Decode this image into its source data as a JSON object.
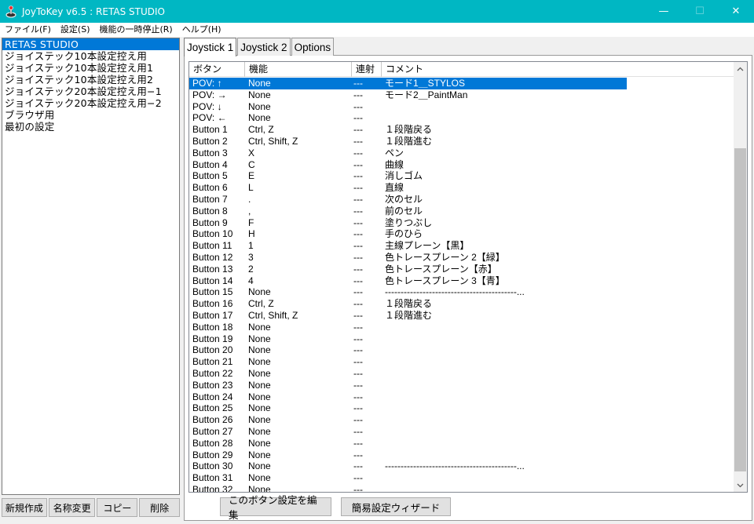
{
  "window": {
    "title": "JoyToKey v6.5 : RETAS STUDIO",
    "minimize": "—",
    "maximize": "☐",
    "close": "✕"
  },
  "menubar": [
    "ファイル(F)",
    "設定(S)",
    "機能の一時停止(R)",
    "ヘルプ(H)"
  ],
  "profiles": {
    "selected_index": 0,
    "items": [
      "RETAS STUDIO",
      "ジョイステック10本設定控え用",
      "ジョイステック10本設定控え用1",
      "ジョイステック10本設定控え用2",
      "ジョイステック20本設定控え用−1",
      "ジョイステック20本設定控え用−2",
      "ブラウザ用",
      "最初の設定"
    ]
  },
  "profile_buttons": {
    "new": "新規作成",
    "rename": "名称変更",
    "copy": "コピー",
    "delete": "削除"
  },
  "tabs": [
    {
      "label": "Joystick 1",
      "active": true
    },
    {
      "label": "Joystick 2",
      "active": false
    },
    {
      "label": "Options",
      "active": false
    }
  ],
  "table": {
    "headers": [
      "ボタン",
      "機能",
      "連射",
      "コメント"
    ],
    "rows": [
      {
        "button": "POV: ↑",
        "func": "None",
        "rapid": "---",
        "comment": "モード1＿STYLOS",
        "selected": true
      },
      {
        "button": "POV: →",
        "func": "None",
        "rapid": "---",
        "comment": "モード2＿PaintMan"
      },
      {
        "button": "POV: ↓",
        "func": "None",
        "rapid": "---",
        "comment": ""
      },
      {
        "button": "POV: ←",
        "func": "None",
        "rapid": "---",
        "comment": ""
      },
      {
        "button": "Button 1",
        "func": "Ctrl, Z",
        "rapid": "---",
        "comment": "１段階戻る"
      },
      {
        "button": "Button 2",
        "func": "Ctrl, Shift, Z",
        "rapid": "---",
        "comment": "１段階進む"
      },
      {
        "button": "Button 3",
        "func": "X",
        "rapid": "---",
        "comment": "ペン"
      },
      {
        "button": "Button 4",
        "func": "C",
        "rapid": "---",
        "comment": "曲線"
      },
      {
        "button": "Button 5",
        "func": "E",
        "rapid": "---",
        "comment": "消しゴム"
      },
      {
        "button": "Button 6",
        "func": "L",
        "rapid": "---",
        "comment": "直線"
      },
      {
        "button": "Button 7",
        "func": ".",
        "rapid": "---",
        "comment": "次のセル"
      },
      {
        "button": "Button 8",
        "func": ",",
        "rapid": "---",
        "comment": "前のセル"
      },
      {
        "button": "Button 9",
        "func": "F",
        "rapid": "---",
        "comment": "塗りつぶし"
      },
      {
        "button": "Button 10",
        "func": "H",
        "rapid": "---",
        "comment": "手のひら"
      },
      {
        "button": "Button 11",
        "func": "1",
        "rapid": "---",
        "comment": "主線プレーン【黒】"
      },
      {
        "button": "Button 12",
        "func": "3",
        "rapid": "---",
        "comment": "色トレースプレーン 2【緑】"
      },
      {
        "button": "Button 13",
        "func": "2",
        "rapid": "---",
        "comment": "色トレースプレーン【赤】"
      },
      {
        "button": "Button 14",
        "func": "4",
        "rapid": "---",
        "comment": "色トレースプレーン 3【青】"
      },
      {
        "button": "Button 15",
        "func": "None",
        "rapid": "---",
        "comment": "------------------------------------------..."
      },
      {
        "button": "Button 16",
        "func": "Ctrl, Z",
        "rapid": "---",
        "comment": "１段階戻る"
      },
      {
        "button": "Button 17",
        "func": "Ctrl, Shift, Z",
        "rapid": "---",
        "comment": "１段階進む"
      },
      {
        "button": "Button 18",
        "func": "None",
        "rapid": "---",
        "comment": ""
      },
      {
        "button": "Button 19",
        "func": "None",
        "rapid": "---",
        "comment": ""
      },
      {
        "button": "Button 20",
        "func": "None",
        "rapid": "---",
        "comment": ""
      },
      {
        "button": "Button 21",
        "func": "None",
        "rapid": "---",
        "comment": ""
      },
      {
        "button": "Button 22",
        "func": "None",
        "rapid": "---",
        "comment": ""
      },
      {
        "button": "Button 23",
        "func": "None",
        "rapid": "---",
        "comment": ""
      },
      {
        "button": "Button 24",
        "func": "None",
        "rapid": "---",
        "comment": ""
      },
      {
        "button": "Button 25",
        "func": "None",
        "rapid": "---",
        "comment": ""
      },
      {
        "button": "Button 26",
        "func": "None",
        "rapid": "---",
        "comment": ""
      },
      {
        "button": "Button 27",
        "func": "None",
        "rapid": "---",
        "comment": ""
      },
      {
        "button": "Button 28",
        "func": "None",
        "rapid": "---",
        "comment": ""
      },
      {
        "button": "Button 29",
        "func": "None",
        "rapid": "---",
        "comment": ""
      },
      {
        "button": "Button 30",
        "func": "None",
        "rapid": "---",
        "comment": "------------------------------------------..."
      },
      {
        "button": "Button 31",
        "func": "None",
        "rapid": "---",
        "comment": ""
      },
      {
        "button": "Button 32",
        "func": "None",
        "rapid": "---",
        "comment": ""
      }
    ]
  },
  "action_buttons": {
    "edit": "このボタン設定を編集",
    "wizard": "簡易設定ウィザード"
  },
  "colors": {
    "titlebar": "#00b7c3",
    "selection": "#0078d7"
  },
  "icons": {
    "app": "joystick-icon",
    "scroll_up": "chevron-up-icon",
    "scroll_down": "chevron-down-icon"
  }
}
